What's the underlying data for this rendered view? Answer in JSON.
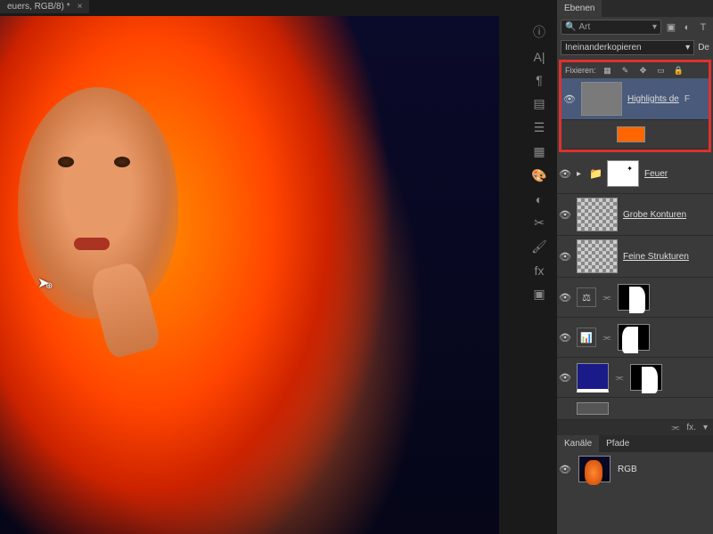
{
  "tab": {
    "title": "euers, RGB/8) *"
  },
  "panels": {
    "layersTab": "Ebenen",
    "searchLabel": "Art",
    "filterIcons": [
      "img",
      "adj",
      "T"
    ],
    "blendMode": "Ineinanderkopieren",
    "opacityLabel": "De",
    "lockLabel": "Fixieren:",
    "lockIcons": [
      "▦",
      "✎",
      "⊕",
      "✥",
      "🔒"
    ]
  },
  "layers": [
    {
      "name": "Highlights de",
      "fx": "F",
      "selected": true
    },
    {
      "name": "Feuer",
      "group": true
    },
    {
      "name": "Grobe Konturen"
    },
    {
      "name": "Feine Strukturen"
    },
    {
      "name": "",
      "adj": "⚖"
    },
    {
      "name": "",
      "adj": "👑"
    },
    {
      "name": ""
    }
  ],
  "bottomStrip": [
    "⫘",
    "fx.",
    "▾"
  ],
  "channels": {
    "tab1": "Kanäle",
    "tab2": "Pfade",
    "rgb": "RGB"
  }
}
